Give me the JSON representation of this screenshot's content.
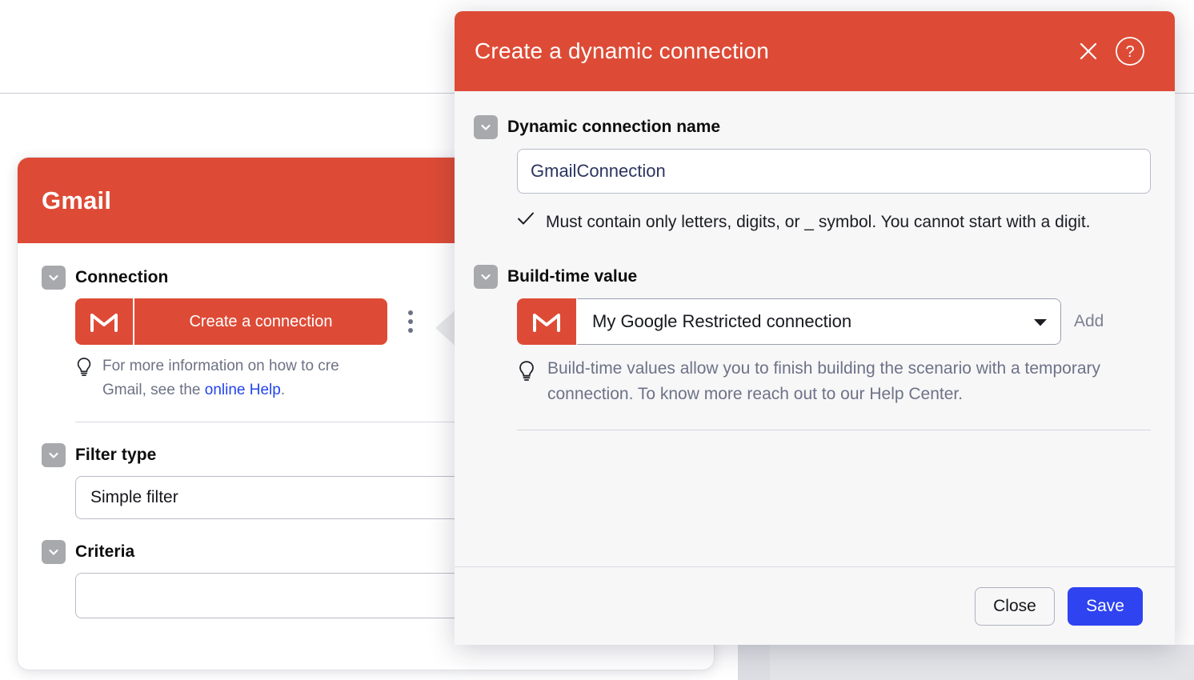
{
  "background": {
    "module_card": {
      "title": "Gmail",
      "fields": [
        {
          "label": "Connection",
          "button_label": "Create a connection",
          "icon": "gmail-m-icon",
          "hint_prefix": "For more information on how to cre",
          "hint_line2_prefix": "Gmail, see the ",
          "hint_link": "online Help",
          "hint_suffix": "."
        },
        {
          "label": "Filter type",
          "value": "Simple filter"
        },
        {
          "label": "Criteria",
          "value": ""
        }
      ]
    }
  },
  "modal": {
    "title": "Create a dynamic connection",
    "close_icon": "close-icon",
    "help_icon": "question-circle-icon",
    "name_field": {
      "label": "Dynamic connection name",
      "value": "GmailConnection",
      "placeholder": "",
      "validation_icon": "check-icon",
      "validation_text": "Must contain only letters, digits, or _ symbol. You cannot start with a digit."
    },
    "build_time_field": {
      "label": "Build-time value",
      "icon": "gmail-m-icon",
      "selected": "My Google Restricted connection",
      "add_label": "Add",
      "hint_icon": "lightbulb-icon",
      "hint_text": "Build-time values allow you to finish building the scenario with a temporary connection. To know more reach out to our Help Center."
    },
    "footer": {
      "close_label": "Close",
      "save_label": "Save"
    }
  },
  "colors": {
    "brand_red": "#dd4b36",
    "primary_blue": "#2f43f0",
    "link_blue": "#2244ee",
    "hint_gray": "#6d7287",
    "chevron_gray": "#a8a9ad"
  }
}
